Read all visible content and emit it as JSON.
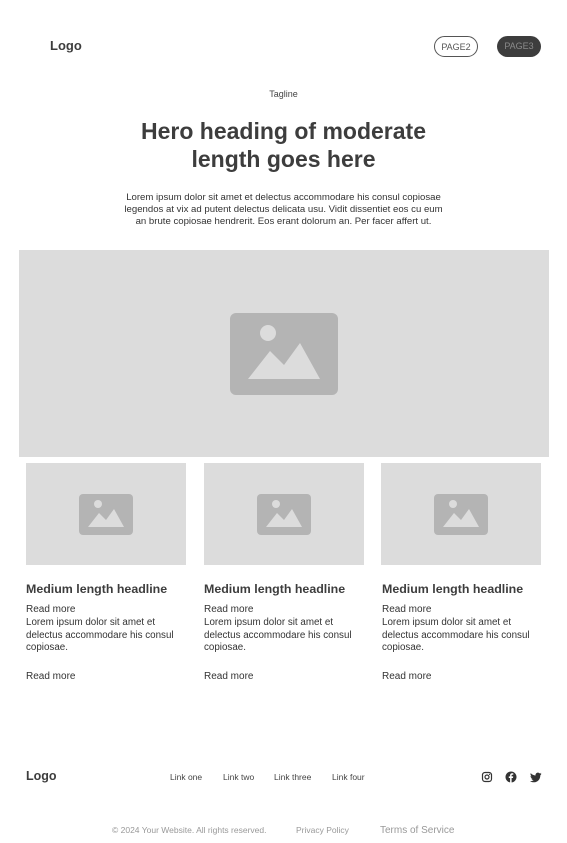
{
  "header": {
    "logo": "Logo",
    "nav": [
      {
        "label": "PAGE2",
        "style": "outline"
      },
      {
        "label": "PAGE3",
        "style": "filled"
      }
    ]
  },
  "hero": {
    "tagline": "Tagline",
    "heading": "Hero heading of moderate length goes here",
    "body": "Lorem ipsum dolor sit amet et delectus accommodare his consul copiosae legendos at vix ad putent delectus delicata usu. Vidit dissentiet eos cu eum an brute copiosae hendrerit. Eos erant dolorum an. Per facer affert ut.",
    "image_icon": "image-placeholder-icon"
  },
  "cards": [
    {
      "headline": "Medium length headline",
      "read_more_top": "Read more",
      "body": "Lorem ipsum dolor sit amet et delectus accommodare his consul copiosae.",
      "read_more": "Read more"
    },
    {
      "headline": "Medium length headline",
      "read_more_top": "Read more",
      "body": "Lorem ipsum dolor sit amet et delectus accommodare his consul copiosae.",
      "read_more": "Read more"
    },
    {
      "headline": "Medium length headline",
      "read_more_top": "Read more",
      "body": "Lorem ipsum dolor sit amet et delectus accommodare his consul copiosae.",
      "read_more": "Read more"
    }
  ],
  "footer": {
    "logo": "Logo",
    "links": [
      "Link one",
      "Link two",
      "Link three",
      "Link four"
    ],
    "social": [
      "instagram-icon",
      "facebook-icon",
      "twitter-icon"
    ],
    "copyright": "© 2024 Your Website. All rights reserved.",
    "privacy": "Privacy Policy",
    "terms": "Terms of Service"
  },
  "colors": {
    "text": "#3d3d3d",
    "placeholder_bg": "#dcdcdc",
    "placeholder_icon": "#b4b4b4",
    "button_filled": "#3d3d3d"
  }
}
